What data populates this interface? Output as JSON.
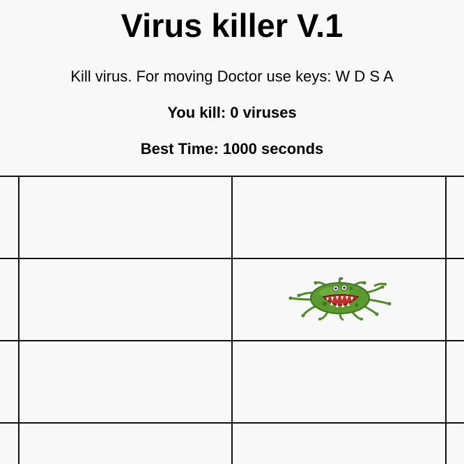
{
  "game": {
    "title": "Virus killer V.1",
    "instructions": "Kill virus. For moving Doctor use keys: W D S A",
    "kills_text": "You kill: 0 viruses",
    "best_time_text": "Best Time: 1000 seconds"
  },
  "board": {
    "virus_cell": {
      "row": 1,
      "col": 1
    }
  },
  "colors": {
    "background": "#f8f8f8",
    "grid_line": "#111111",
    "virus_body": "#5a9a2e",
    "virus_mouth": "#c0302a"
  },
  "icons": {
    "virus": "virus-icon"
  }
}
